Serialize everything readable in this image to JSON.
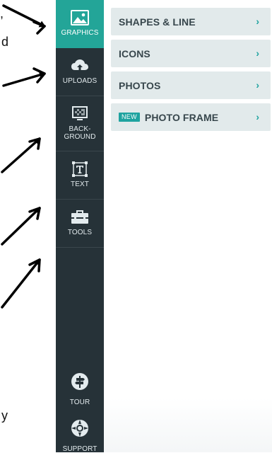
{
  "annotation": {
    "line_1": ",",
    "line_2": "d",
    "line_3": "y"
  },
  "sidebar": {
    "items": [
      {
        "label": "GRAPHICS",
        "icon": "image-icon",
        "active": true
      },
      {
        "label": "UPLOADS",
        "icon": "cloud-upload-icon"
      },
      {
        "label_line1": "BACK-",
        "label_line2": "GROUND",
        "icon": "background-icon"
      },
      {
        "label": "TEXT",
        "icon": "text-icon"
      },
      {
        "label": "TOOLS",
        "icon": "toolbox-icon"
      }
    ],
    "bottom": [
      {
        "label": "TOUR",
        "icon": "signpost-icon"
      },
      {
        "label": "SUPPORT",
        "icon": "lifebuoy-icon"
      }
    ]
  },
  "panel": {
    "rows": [
      {
        "label": "SHAPES & LINE",
        "chevron": "›"
      },
      {
        "label": "ICONS",
        "chevron": "›"
      },
      {
        "label": "PHOTOS",
        "chevron": "›"
      },
      {
        "badge": "NEW",
        "label": "PHOTO FRAME",
        "chevron": "›"
      }
    ]
  },
  "colors": {
    "sidebar_bg": "#263238",
    "active_bg": "#23a598",
    "row_bg": "#e2eaeb",
    "accent": "#1fa3a0",
    "row_text": "#37464c"
  }
}
